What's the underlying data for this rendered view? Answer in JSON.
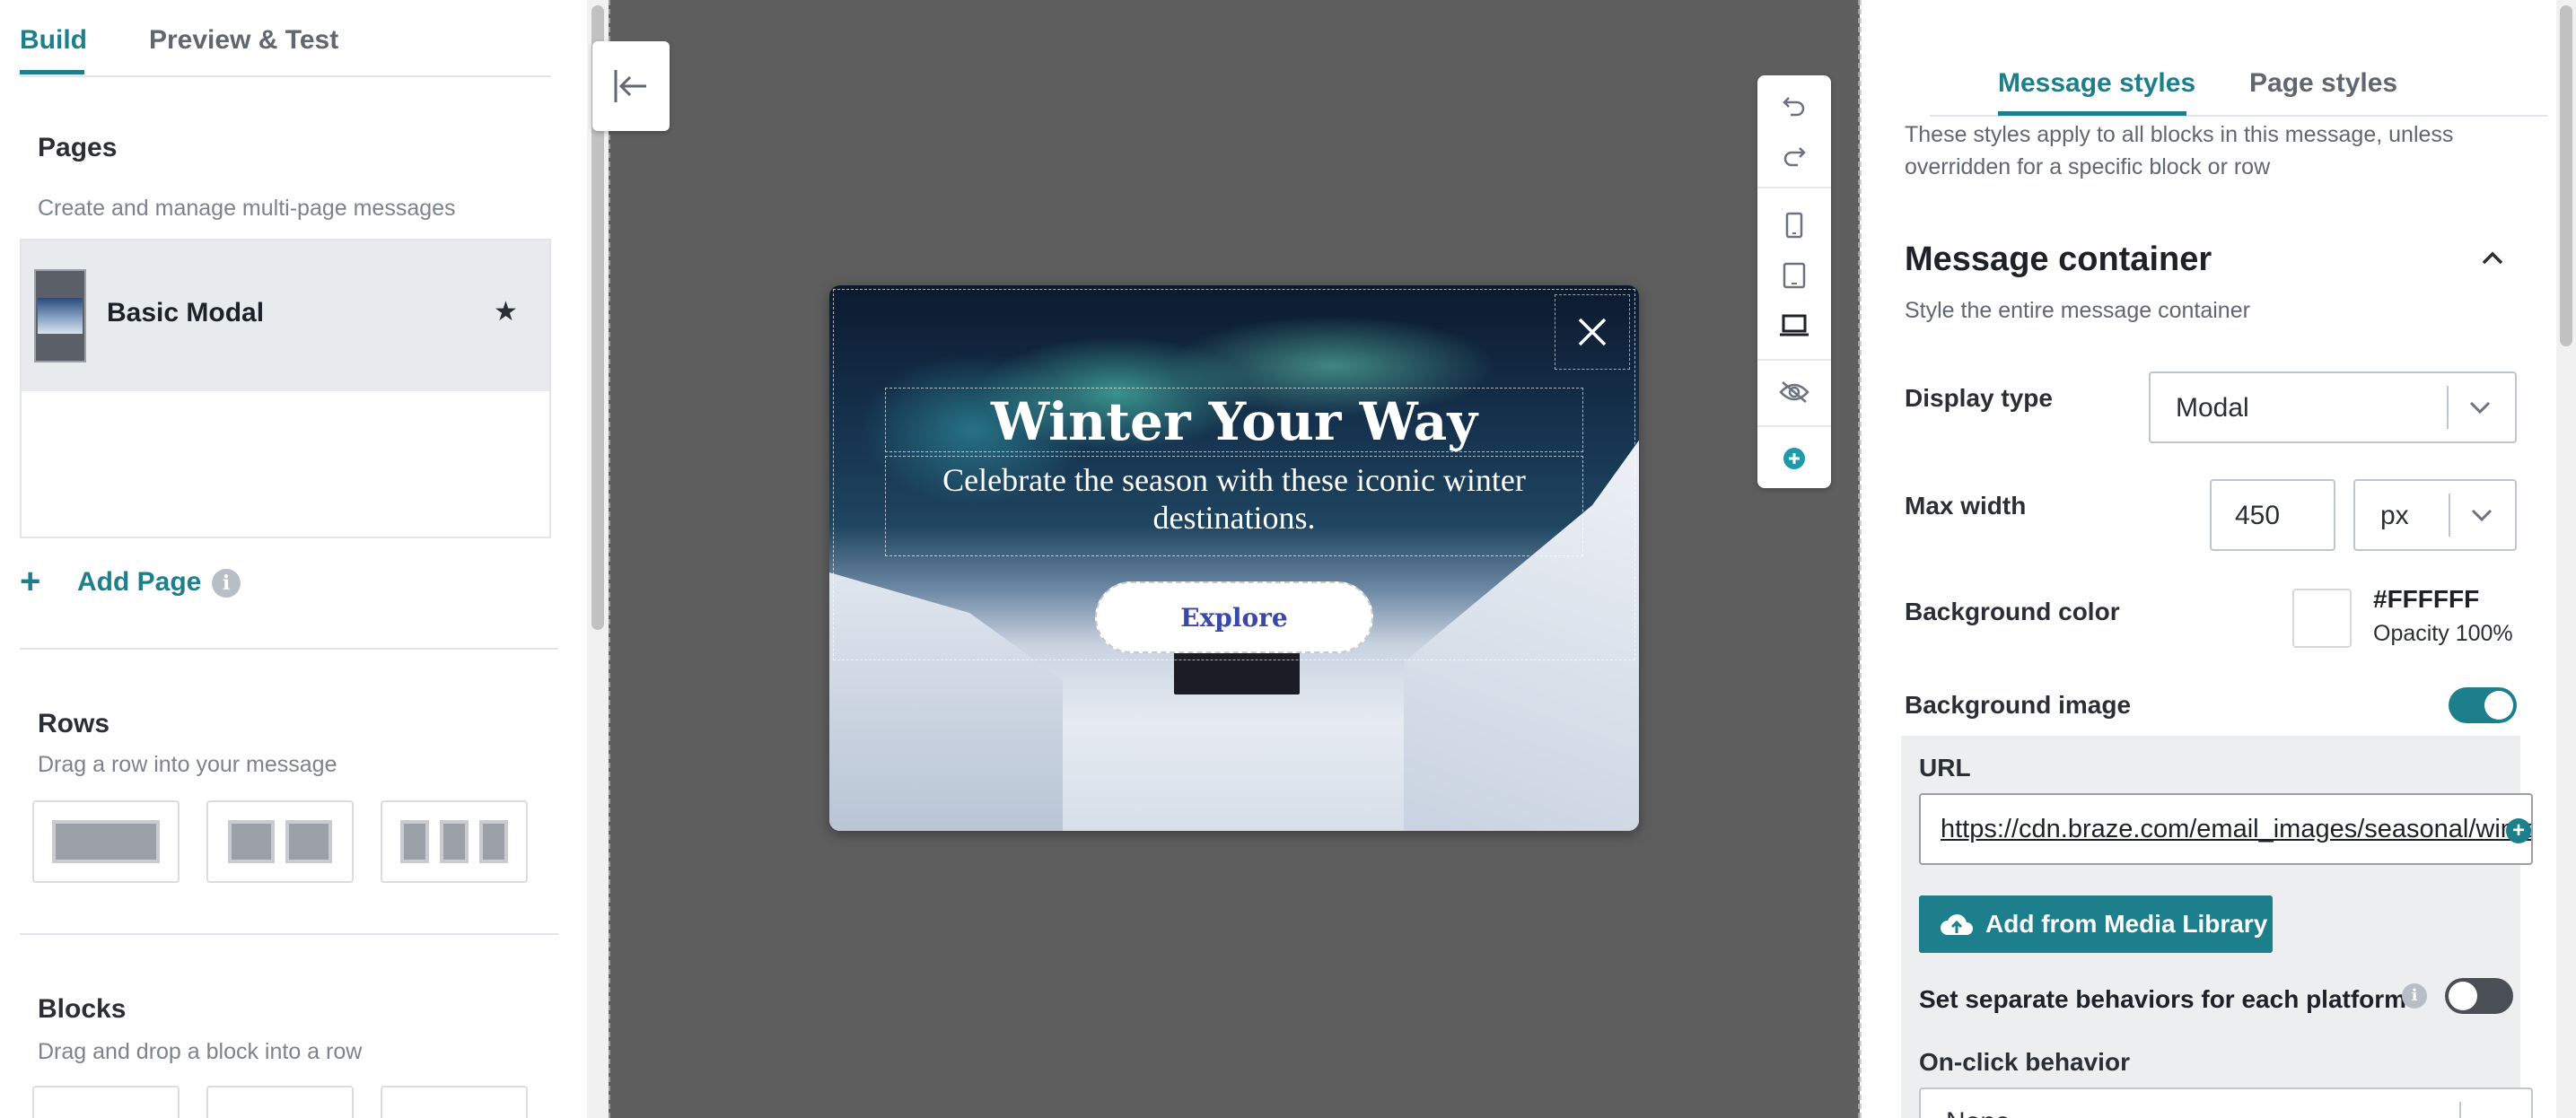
{
  "left_panel": {
    "tabs": [
      {
        "label": "Build",
        "active": true
      },
      {
        "label": "Preview & Test",
        "active": false
      }
    ],
    "pages": {
      "title": "Pages",
      "subtitle": "Create and manage multi-page messages",
      "items": [
        {
          "name": "Basic Modal",
          "starred": true
        }
      ],
      "add_label": "Add Page"
    },
    "rows": {
      "title": "Rows",
      "subtitle": "Drag a row into your message"
    },
    "blocks": {
      "title": "Blocks",
      "subtitle": "Drag and drop a block into a row"
    }
  },
  "canvas": {
    "modal": {
      "title": "Winter Your Way",
      "subtitle": "Celebrate the season with these iconic winter destinations.",
      "button_label": "Explore"
    },
    "toolbar_icons": [
      "undo-icon",
      "redo-icon",
      "mobile-icon",
      "tablet-icon",
      "desktop-icon",
      "hide-icon",
      "add-icon"
    ]
  },
  "right_panel": {
    "tabs": [
      {
        "label": "Message styles",
        "active": true
      },
      {
        "label": "Page styles",
        "active": false
      }
    ],
    "description": "These styles apply to all blocks in this message, unless overridden for a specific block or row",
    "section": {
      "title": "Message container",
      "subtitle": "Style the entire message container"
    },
    "display_type": {
      "label": "Display type",
      "value": "Modal"
    },
    "max_width": {
      "label": "Max width",
      "value": "450",
      "unit": "px"
    },
    "background_color": {
      "label": "Background color",
      "hex": "#FFFFFF",
      "opacity": "Opacity 100%"
    },
    "background_image": {
      "label": "Background image",
      "enabled": true,
      "url_label": "URL",
      "url_value": "https://cdn.braze.com/email_images/seasonal/winter",
      "media_button": "Add from Media Library",
      "separate_behaviors_label": "Set separate behaviors for each platform",
      "separate_behaviors_enabled": false,
      "onclick_label": "On-click behavior",
      "onclick_value": "None"
    }
  },
  "colors": {
    "accent": "#1e7f8c",
    "canvas_bg": "#5e5e5e",
    "button_text": "#3a48a8"
  }
}
